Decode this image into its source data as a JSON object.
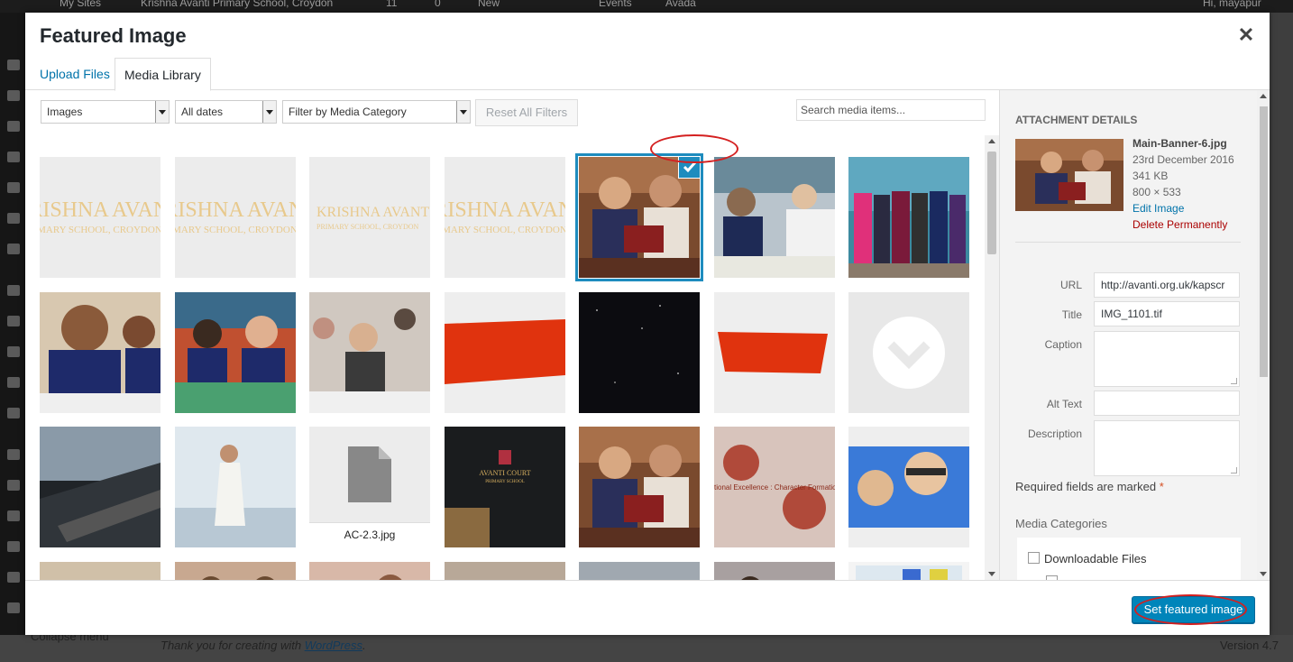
{
  "admin_bar": {
    "my_sites": "My Sites",
    "site_name": "Krishna Avanti Primary School, Croydon",
    "updates": "11",
    "comments": "0",
    "new": "New",
    "events": "Events",
    "avada": "Avada",
    "greeting": "Hi, mayapur"
  },
  "admin_footer": {
    "thanks": "Thank you for creating with",
    "wp_link": "WordPress",
    "version": "Version 4.7",
    "collapse": "Collapse menu"
  },
  "modal": {
    "title": "Featured Image",
    "close_icon": "close-icon",
    "tabs": [
      {
        "label": "Upload Files"
      },
      {
        "label": "Media Library"
      }
    ]
  },
  "toolbar": {
    "type_filter": "Images",
    "date_filter": "All dates",
    "category_filter": "Filter by Media Category",
    "reset_label": "Reset All Filters",
    "search_placeholder": "Search media items..."
  },
  "grid": {
    "watermark_text": "KRISHNA AVANTI",
    "watermark_sub": "PRIMARY SCHOOL, CROYDON",
    "file_item_name": "AC-2.3.jpg",
    "logo_text": "AVANTI COURT",
    "logo_sub": "PRIMARY SCHOOL",
    "character_text": "tional Excellence : Character Formation"
  },
  "details": {
    "heading": "Attachment Details",
    "filename": "Main-Banner-6.jpg",
    "date": "23rd December 2016",
    "size": "341 KB",
    "dimensions": "800 × 533",
    "edit_link": "Edit Image",
    "delete_link": "Delete Permanently",
    "url_label": "URL",
    "url_value": "http://avanti.org.uk/kapscr",
    "title_label": "Title",
    "title_value": "IMG_1101.tif",
    "caption_label": "Caption",
    "alt_label": "Alt Text",
    "description_label": "Description",
    "required_note": "Required fields are marked",
    "required_star": "*",
    "categories_title": "Media Categories",
    "category_item": "Downloadable Files"
  },
  "footer": {
    "set_button": "Set featured image"
  }
}
